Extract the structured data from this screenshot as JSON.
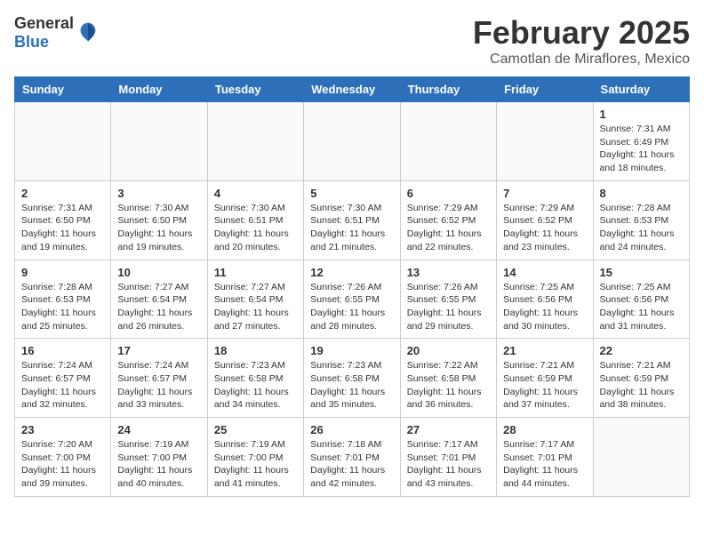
{
  "header": {
    "logo_general": "General",
    "logo_blue": "Blue",
    "title": "February 2025",
    "subtitle": "Camotlan de Miraflores, Mexico"
  },
  "weekdays": [
    "Sunday",
    "Monday",
    "Tuesday",
    "Wednesday",
    "Thursday",
    "Friday",
    "Saturday"
  ],
  "weeks": [
    [
      {
        "day": "",
        "info": ""
      },
      {
        "day": "",
        "info": ""
      },
      {
        "day": "",
        "info": ""
      },
      {
        "day": "",
        "info": ""
      },
      {
        "day": "",
        "info": ""
      },
      {
        "day": "",
        "info": ""
      },
      {
        "day": "1",
        "info": "Sunrise: 7:31 AM\nSunset: 6:49 PM\nDaylight: 11 hours\nand 18 minutes."
      }
    ],
    [
      {
        "day": "2",
        "info": "Sunrise: 7:31 AM\nSunset: 6:50 PM\nDaylight: 11 hours\nand 19 minutes."
      },
      {
        "day": "3",
        "info": "Sunrise: 7:30 AM\nSunset: 6:50 PM\nDaylight: 11 hours\nand 19 minutes."
      },
      {
        "day": "4",
        "info": "Sunrise: 7:30 AM\nSunset: 6:51 PM\nDaylight: 11 hours\nand 20 minutes."
      },
      {
        "day": "5",
        "info": "Sunrise: 7:30 AM\nSunset: 6:51 PM\nDaylight: 11 hours\nand 21 minutes."
      },
      {
        "day": "6",
        "info": "Sunrise: 7:29 AM\nSunset: 6:52 PM\nDaylight: 11 hours\nand 22 minutes."
      },
      {
        "day": "7",
        "info": "Sunrise: 7:29 AM\nSunset: 6:52 PM\nDaylight: 11 hours\nand 23 minutes."
      },
      {
        "day": "8",
        "info": "Sunrise: 7:28 AM\nSunset: 6:53 PM\nDaylight: 11 hours\nand 24 minutes."
      }
    ],
    [
      {
        "day": "9",
        "info": "Sunrise: 7:28 AM\nSunset: 6:53 PM\nDaylight: 11 hours\nand 25 minutes."
      },
      {
        "day": "10",
        "info": "Sunrise: 7:27 AM\nSunset: 6:54 PM\nDaylight: 11 hours\nand 26 minutes."
      },
      {
        "day": "11",
        "info": "Sunrise: 7:27 AM\nSunset: 6:54 PM\nDaylight: 11 hours\nand 27 minutes."
      },
      {
        "day": "12",
        "info": "Sunrise: 7:26 AM\nSunset: 6:55 PM\nDaylight: 11 hours\nand 28 minutes."
      },
      {
        "day": "13",
        "info": "Sunrise: 7:26 AM\nSunset: 6:55 PM\nDaylight: 11 hours\nand 29 minutes."
      },
      {
        "day": "14",
        "info": "Sunrise: 7:25 AM\nSunset: 6:56 PM\nDaylight: 11 hours\nand 30 minutes."
      },
      {
        "day": "15",
        "info": "Sunrise: 7:25 AM\nSunset: 6:56 PM\nDaylight: 11 hours\nand 31 minutes."
      }
    ],
    [
      {
        "day": "16",
        "info": "Sunrise: 7:24 AM\nSunset: 6:57 PM\nDaylight: 11 hours\nand 32 minutes."
      },
      {
        "day": "17",
        "info": "Sunrise: 7:24 AM\nSunset: 6:57 PM\nDaylight: 11 hours\nand 33 minutes."
      },
      {
        "day": "18",
        "info": "Sunrise: 7:23 AM\nSunset: 6:58 PM\nDaylight: 11 hours\nand 34 minutes."
      },
      {
        "day": "19",
        "info": "Sunrise: 7:23 AM\nSunset: 6:58 PM\nDaylight: 11 hours\nand 35 minutes."
      },
      {
        "day": "20",
        "info": "Sunrise: 7:22 AM\nSunset: 6:58 PM\nDaylight: 11 hours\nand 36 minutes."
      },
      {
        "day": "21",
        "info": "Sunrise: 7:21 AM\nSunset: 6:59 PM\nDaylight: 11 hours\nand 37 minutes."
      },
      {
        "day": "22",
        "info": "Sunrise: 7:21 AM\nSunset: 6:59 PM\nDaylight: 11 hours\nand 38 minutes."
      }
    ],
    [
      {
        "day": "23",
        "info": "Sunrise: 7:20 AM\nSunset: 7:00 PM\nDaylight: 11 hours\nand 39 minutes."
      },
      {
        "day": "24",
        "info": "Sunrise: 7:19 AM\nSunset: 7:00 PM\nDaylight: 11 hours\nand 40 minutes."
      },
      {
        "day": "25",
        "info": "Sunrise: 7:19 AM\nSunset: 7:00 PM\nDaylight: 11 hours\nand 41 minutes."
      },
      {
        "day": "26",
        "info": "Sunrise: 7:18 AM\nSunset: 7:01 PM\nDaylight: 11 hours\nand 42 minutes."
      },
      {
        "day": "27",
        "info": "Sunrise: 7:17 AM\nSunset: 7:01 PM\nDaylight: 11 hours\nand 43 minutes."
      },
      {
        "day": "28",
        "info": "Sunrise: 7:17 AM\nSunset: 7:01 PM\nDaylight: 11 hours\nand 44 minutes."
      },
      {
        "day": "",
        "info": ""
      }
    ]
  ]
}
